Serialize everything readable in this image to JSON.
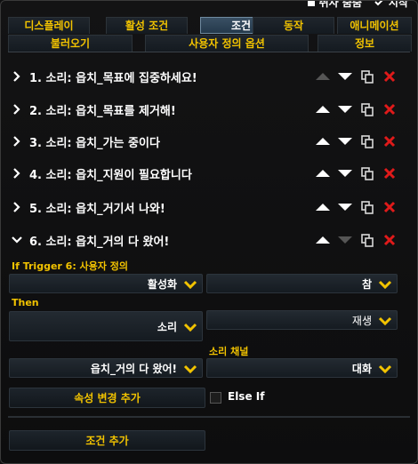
{
  "top_partial": {
    "left_label": "취사 줌줌",
    "right_label": "시작"
  },
  "tabs_row1": [
    {
      "label": "디스플레이",
      "active": false
    },
    {
      "label": "활성 조건",
      "active": false
    },
    {
      "label": "조건",
      "active": true
    },
    {
      "label": "동작",
      "active": false
    },
    {
      "label": "애니메이션",
      "active": false
    }
  ],
  "tabs_row2": [
    {
      "label": "불러오기"
    },
    {
      "label": "사용자 정의 옵션"
    },
    {
      "label": "정보"
    }
  ],
  "triggers": [
    {
      "label": "1. 소리: 읍치_목표에 집중하세요!",
      "expanded": false,
      "up_enabled": false,
      "down_enabled": true
    },
    {
      "label": "2. 소리: 읍치_목표를 제거해!",
      "expanded": false,
      "up_enabled": true,
      "down_enabled": true
    },
    {
      "label": "3. 소리: 읍치_가는 중이다",
      "expanded": false,
      "up_enabled": true,
      "down_enabled": true
    },
    {
      "label": "4. 소리: 읍치_지원이 필요합니다",
      "expanded": false,
      "up_enabled": true,
      "down_enabled": true
    },
    {
      "label": "5. 소리: 읍치_거기서 나와!",
      "expanded": false,
      "up_enabled": true,
      "down_enabled": true
    },
    {
      "label": "6. 소리: 읍치_거의 다 왔어!",
      "expanded": true,
      "up_enabled": true,
      "down_enabled": false
    }
  ],
  "if_section": {
    "title": "If Trigger 6: 사용자 정의",
    "property": "활성화",
    "value": "참"
  },
  "then_section": {
    "title": "Then",
    "action": "소리",
    "action_type": "재생",
    "channel_label": "소리 채널",
    "sound": "읍치_거의 다 왔어!",
    "channel": "대화"
  },
  "buttons": {
    "add_property": "속성 변경 추가",
    "else_if": "Else If",
    "add_condition": "조건 추가"
  },
  "colors": {
    "accent_yellow": "#f2c300",
    "delete_red": "#e01a1a",
    "active_tab": "#2f4557"
  }
}
